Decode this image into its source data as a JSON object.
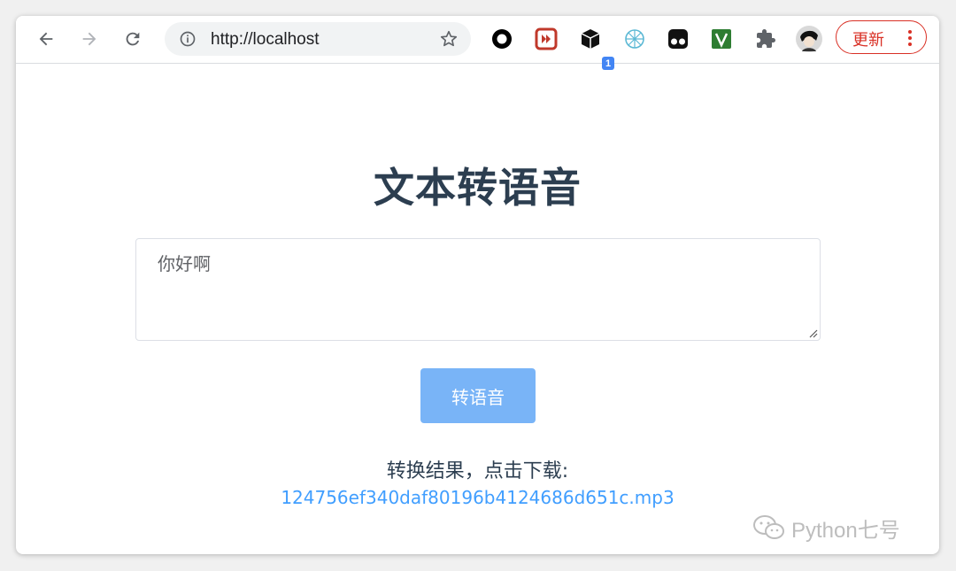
{
  "browser": {
    "url": "http://localhost",
    "extension_badge": "1",
    "update_label": "更新"
  },
  "page": {
    "title": "文本转语音",
    "textarea_value": "你好啊",
    "convert_button": "转语音",
    "result_label": "转换结果，点击下载:",
    "result_link": "124756ef340daf80196b4124686d651c.mp3"
  },
  "watermark": {
    "text": "Python七号"
  },
  "colors": {
    "title": "#2c3e50",
    "button": "#79b4f7",
    "link": "#409eff",
    "update": "#d93025"
  },
  "icons": [
    "back-icon",
    "forward-icon",
    "reload-icon",
    "info-icon",
    "star-icon",
    "extensions-icon",
    "profile-avatar",
    "more-vert-icon"
  ]
}
